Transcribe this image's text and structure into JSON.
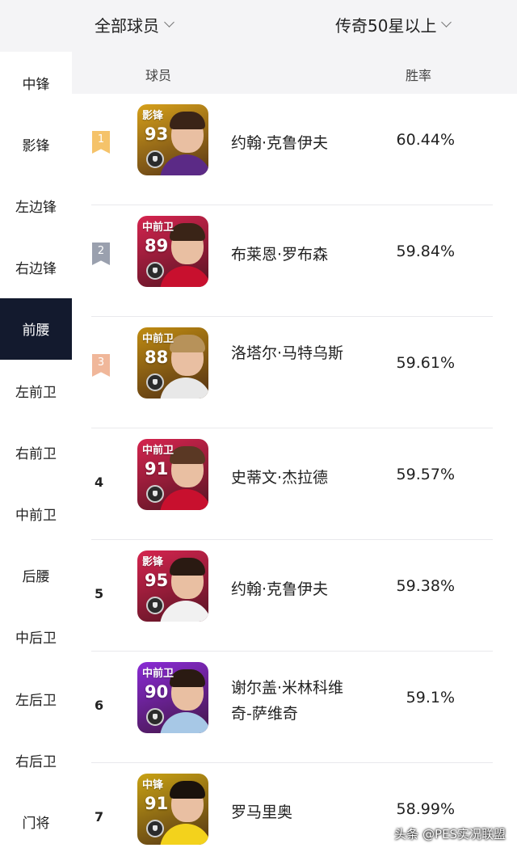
{
  "filters": {
    "left": "全部球员",
    "right": "传奇50星以上"
  },
  "sidebar": {
    "items": [
      "中锋",
      "影锋",
      "左边锋",
      "右边锋",
      "前腰",
      "左前卫",
      "右前卫",
      "中前卫",
      "后腰",
      "中后卫",
      "左后卫",
      "右后卫",
      "门将"
    ],
    "active": "前腰"
  },
  "table": {
    "col_player": "球员",
    "col_rate": "胜率"
  },
  "rows": [
    {
      "rank": "1",
      "position": "影锋",
      "rating": "93",
      "name": "约翰·克鲁伊夫",
      "rate": "60.44%",
      "badge_color": "#f5c36a",
      "card_color": "#d7a11a",
      "hair": "#3a2417",
      "shirt": "#5b2a86"
    },
    {
      "rank": "2",
      "position": "中前卫",
      "rating": "89",
      "name": "布莱恩·罗布森",
      "rate": "59.84%",
      "badge_color": "#9aa0ae",
      "card_color": "#d6244f",
      "hair": "#3a2417",
      "shirt": "#c8102e"
    },
    {
      "rank": "3",
      "position": "中前卫",
      "rating": "88",
      "name": "洛塔尔·马特乌斯",
      "rate": "59.61%",
      "badge_color": "#f0b79a",
      "card_color": "#c08c12",
      "hair": "#b7925a",
      "shirt": "#e8e8e8"
    },
    {
      "rank": "4",
      "position": "中前卫",
      "rating": "91",
      "name": "史蒂文·杰拉德",
      "rate": "59.57%",
      "badge_color": "",
      "card_color": "#d6244f",
      "hair": "#5a3824",
      "shirt": "#c8102e"
    },
    {
      "rank": "5",
      "position": "影锋",
      "rating": "95",
      "name": "约翰·克鲁伊夫",
      "rate": "59.38%",
      "badge_color": "",
      "card_color": "#d6244f",
      "hair": "#2a1a12",
      "shirt": "#f1f1f1"
    },
    {
      "rank": "6",
      "position": "中前卫",
      "rating": "90",
      "name": "谢尔盖·米林科维奇-萨维奇",
      "rate": "59.1%",
      "badge_color": "",
      "card_color": "#8a2bd6",
      "hair": "#2a1a12",
      "shirt": "#a7c8e6"
    },
    {
      "rank": "7",
      "position": "中锋",
      "rating": "91",
      "name": "罗马里奥",
      "rate": "58.99%",
      "badge_color": "",
      "card_color": "#c9a214",
      "hair": "#1a120c",
      "shirt": "#f3d21c"
    }
  ],
  "watermark": "头条 @PES实况联盟"
}
